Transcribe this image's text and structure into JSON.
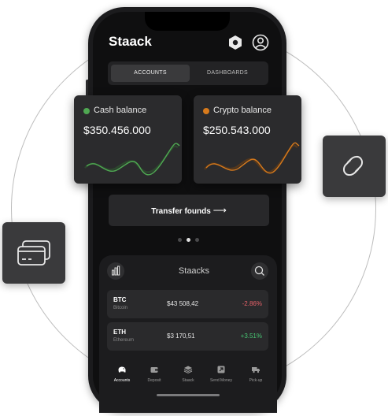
{
  "header": {
    "brand": "Staack"
  },
  "tabs": [
    {
      "label": "ACCOUNTS",
      "active": true
    },
    {
      "label": "DASHBOARDS",
      "active": false
    }
  ],
  "cards": [
    {
      "title": "Cash balance",
      "amount": "$350.456.000",
      "color": "#4fa852"
    },
    {
      "title": "Crypto balance",
      "amount": "$250.543.000",
      "color": "#d77a1c"
    }
  ],
  "transfer": {
    "label": "Transfer founds",
    "icon": "arrow-right-icon"
  },
  "pager": {
    "count": 3,
    "active_index": 1
  },
  "staacks": {
    "title": "Staacks",
    "rows": [
      {
        "symbol": "BTC",
        "name": "Bitcoin",
        "price": "$43 508,42",
        "change": "-2.86%",
        "direction": "down"
      },
      {
        "symbol": "ETH",
        "name": "Ethereum",
        "price": "$3 170,51",
        "change": "+3.51%",
        "direction": "up"
      }
    ]
  },
  "nav": [
    {
      "label": "Accounts",
      "icon": "piggy-bank-icon",
      "active": true
    },
    {
      "label": "Deposit",
      "icon": "wallet-icon",
      "active": false
    },
    {
      "label": "Staack",
      "icon": "layers-icon",
      "active": false
    },
    {
      "label": "Send Money",
      "icon": "send-arrow-icon",
      "active": false
    },
    {
      "label": "Pick-up",
      "icon": "truck-icon",
      "active": false
    }
  ],
  "floating": [
    {
      "name": "cards",
      "icon": "credit-cards-icon"
    },
    {
      "name": "link",
      "icon": "link-icon"
    }
  ],
  "colors": {
    "positive": "#48c774",
    "negative": "#e8626a",
    "cash": "#4fa852",
    "crypto": "#d77a1c"
  }
}
